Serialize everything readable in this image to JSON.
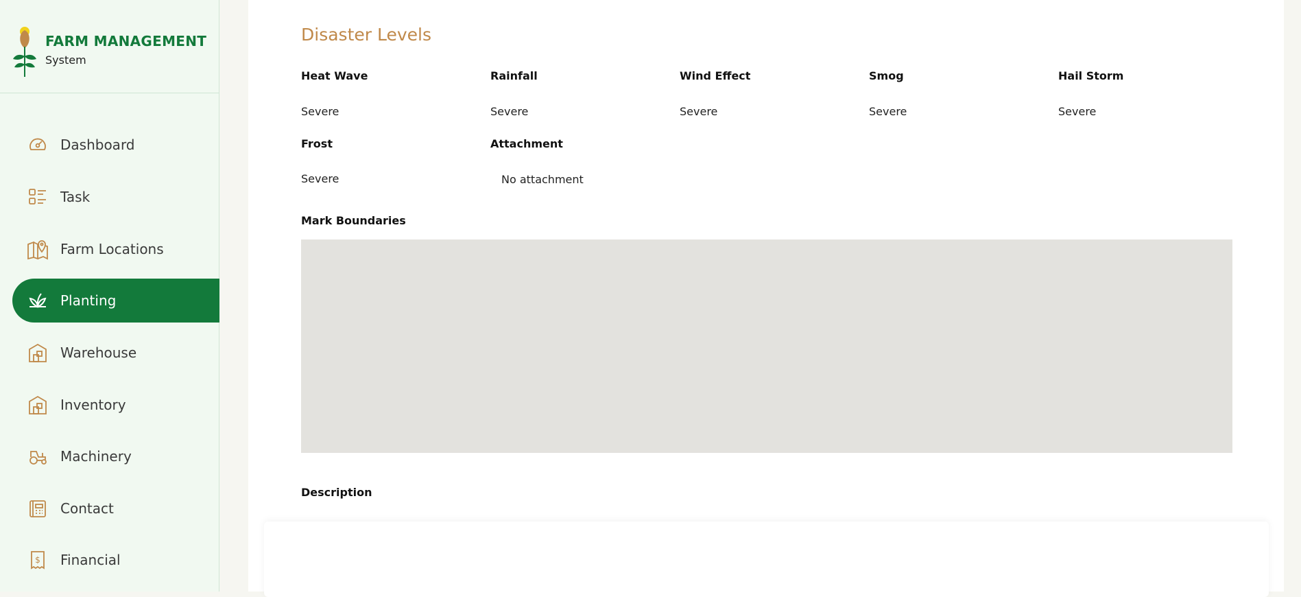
{
  "app": {
    "title": "FARM MANAGEMENT",
    "subtitle": "System"
  },
  "sidebar": {
    "items": [
      {
        "label": "Dashboard",
        "icon": "dashboard-icon"
      },
      {
        "label": "Task",
        "icon": "task-list-icon"
      },
      {
        "label": "Farm Locations",
        "icon": "map-pin-icon"
      },
      {
        "label": "Planting",
        "icon": "plant-icon",
        "active": true
      },
      {
        "label": "Warehouse",
        "icon": "warehouse-icon"
      },
      {
        "label": "Inventory",
        "icon": "inventory-icon"
      },
      {
        "label": "Machinery",
        "icon": "tractor-icon"
      },
      {
        "label": "Contact",
        "icon": "contact-icon"
      },
      {
        "label": "Financial",
        "icon": "receipt-dollar-icon"
      }
    ]
  },
  "main": {
    "section_title": "Disaster Levels",
    "disasters": [
      {
        "label": "Heat Wave",
        "value": "Severe"
      },
      {
        "label": "Rainfall",
        "value": "Severe"
      },
      {
        "label": "Wind Effect",
        "value": "Severe"
      },
      {
        "label": "Smog",
        "value": "Severe"
      },
      {
        "label": "Hail Storm",
        "value": "Severe"
      },
      {
        "label": "Frost",
        "value": "Severe"
      }
    ],
    "attachment_label": "Attachment",
    "attachment_value": "No attachment",
    "boundaries_label": "Mark Boundaries",
    "description_label": "Description"
  },
  "colors": {
    "brand_green": "#137a3b",
    "accent_gold": "#c0894a",
    "sidebar_bg": "#f1f9f1",
    "map_placeholder": "#e3e2de"
  }
}
